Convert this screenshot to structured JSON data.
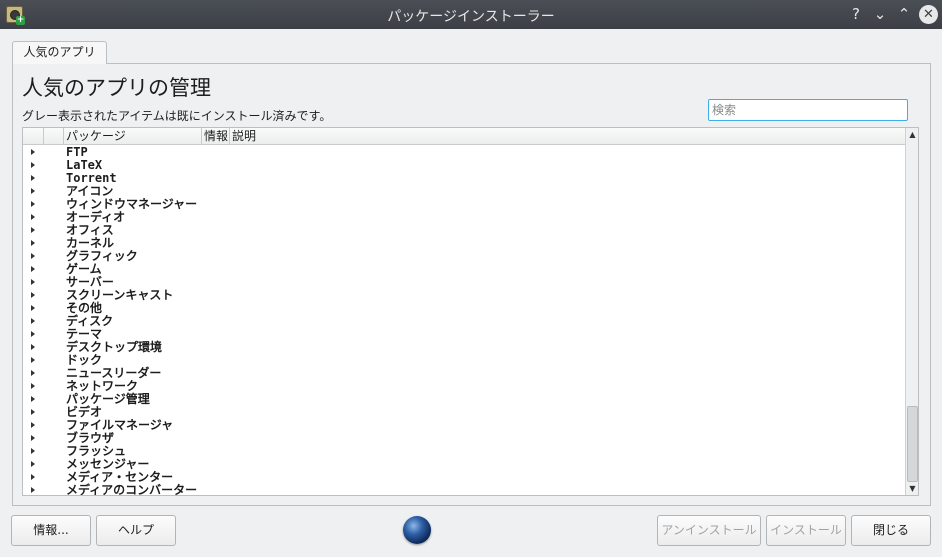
{
  "window": {
    "title": "パッケージインストーラー",
    "help_glyph": "?",
    "minimize_glyph": "⌄",
    "maximize_glyph": "⌃",
    "close_glyph": "✕",
    "icon": "package-installer-icon"
  },
  "tab": {
    "label": "人気のアプリ"
  },
  "main": {
    "heading": "人気のアプリの管理",
    "subtext": "グレー表示されたアイテムは既にインストール済みです。",
    "search_placeholder": "検索"
  },
  "tree": {
    "columns": [
      "パッケージ",
      "情報",
      "説明"
    ],
    "rows": [
      "FTP",
      "LaTeX",
      "Torrent",
      "アイコン",
      "ウィンドウマネージャー",
      "オーディオ",
      "オフィス",
      "カーネル",
      "グラフィック",
      "ゲーム",
      "サーバー",
      "スクリーンキャスト",
      "その他",
      "ディスク",
      "テーマ",
      "デスクトップ環境",
      "ドック",
      "ニュースリーダー",
      "ネットワーク",
      "パッケージ管理",
      "ビデオ",
      "ファイルマネージャ",
      "ブラウザ",
      "フラッシュ",
      "メッセンジャー",
      "メディア・センター",
      "メディアのコンバーター"
    ],
    "scroll_up_glyph": "▲",
    "scroll_down_glyph": "▼"
  },
  "buttons": {
    "about": "情報...",
    "help": "ヘルプ",
    "uninstall": "アンインストール",
    "install": "インストール",
    "close": "閉じる"
  },
  "colors": {
    "titlebar": "#3c4046",
    "accent": "#3daee9",
    "background": "#eff0f1"
  }
}
